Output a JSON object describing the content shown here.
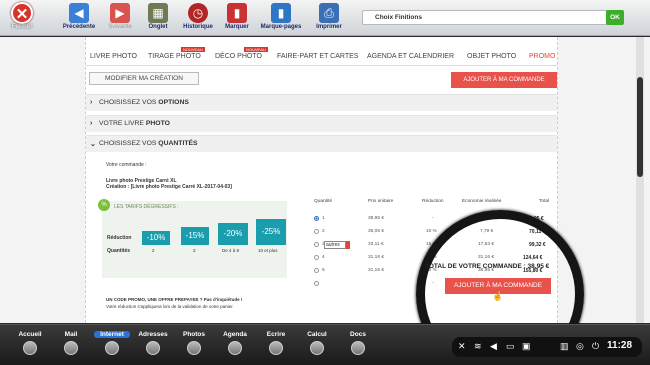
{
  "toolbar": {
    "close_label": "Fermer",
    "buttons": [
      {
        "label": "Précédente",
        "icon": "back-arrow-icon",
        "color": "#3b7fd6"
      },
      {
        "label": "Suivante",
        "icon": "forward-arrow-icon",
        "color": "#d9534f"
      },
      {
        "label": "Onglet",
        "icon": "tab-icon",
        "color": "#6e7a55"
      },
      {
        "label": "Historique",
        "icon": "history-icon",
        "color": "#b32424"
      },
      {
        "label": "Marquer",
        "icon": "bookmark-icon",
        "color": "#c83232"
      },
      {
        "label": "Marque-pages",
        "icon": "bookmarks-list-icon",
        "color": "#2e77c4"
      },
      {
        "label": "Imprimer",
        "icon": "printer-icon",
        "color": "#3b6fb5"
      }
    ],
    "search_value": "Choix Finitions",
    "ok_label": "OK"
  },
  "nav": {
    "tabs": [
      "LIVRE PHOTO",
      "TIRAGE PHOTO",
      "DÉCO PHOTO",
      "FAIRE-PART ET CARTES",
      "AGENDA ET CALENDRIER",
      "OBJET PHOTO",
      "PROMO"
    ],
    "new_badge": "NOUVEAU"
  },
  "actions": {
    "modify_label": "MODIFIER MA CRÉATION",
    "add_to_cart_label": "AJOUTER À MA COMMANDE"
  },
  "sections": {
    "options_prefix": "CHOISISSEZ VOS ",
    "options_bold": "OPTIONS",
    "book_prefix": "VOTRE LIVRE ",
    "book_bold": "PHOTO",
    "qty_prefix": "CHOISISSEZ VOS ",
    "qty_bold": "QUANTITÉS"
  },
  "order": {
    "heading": "Votre commande :",
    "product_line1": "Livre photo Prestige Carré XL",
    "product_line2": "Création : [Livre photo Prestige Carré XL-2017-04-03]",
    "tarifs_title": "LES TARIFS DÉGRESSIFS :",
    "reduction_label": "Réduction",
    "quantities_label": "Quantités",
    "tiers": [
      {
        "pct": "-10%",
        "qty": "2"
      },
      {
        "pct": "-15%",
        "qty": "3"
      },
      {
        "pct": "-20%",
        "qty": "De 4 à 9"
      },
      {
        "pct": "-25%",
        "qty": "10 et plus"
      }
    ],
    "promo_line1": "UN CODE PROMO, UNE OFFRE PREPAYEE ? Pas d'inquiétude !",
    "promo_line2": "Votre réduction s'appliquera lors de la validation de votre panier."
  },
  "table": {
    "headers": [
      "Quantité",
      "Prix unitaire",
      "Réduction",
      "Economie réalisée",
      "Total"
    ],
    "rows": [
      {
        "qty": "1",
        "unit": "38,95 €",
        "reduc": "-",
        "eco": "-",
        "total": "38,95 €",
        "selected": true
      },
      {
        "qty": "2",
        "unit": "35,06 €",
        "reduc": "10 %",
        "eco": "7,79 €",
        "total": "70,11 €",
        "selected": false
      },
      {
        "qty": "3",
        "unit": "33,11 €",
        "reduc": "15 %",
        "eco": "17,53 €",
        "total": "99,32 €",
        "selected": false
      },
      {
        "qty": "4",
        "unit": "31,16 €",
        "reduc": "20 %",
        "eco": "31,16 €",
        "total": "124,64 €",
        "selected": false
      },
      {
        "qty": "5",
        "unit": "31,16 €",
        "reduc": "20 %",
        "eco": "38,95 €",
        "total": "155,80 €",
        "selected": false
      }
    ],
    "other_label": "autres",
    "dash": "-"
  },
  "total": {
    "label": "TOTAL DE VOTRE COMMANDE : 38,95 €"
  },
  "dock": {
    "items": [
      "Accueil",
      "Mail",
      "Internet",
      "Adresses",
      "Photos",
      "Agenda",
      "Ecrire",
      "Calcul",
      "Docs"
    ],
    "active": "Internet"
  },
  "tray": {
    "time": "11:28"
  }
}
